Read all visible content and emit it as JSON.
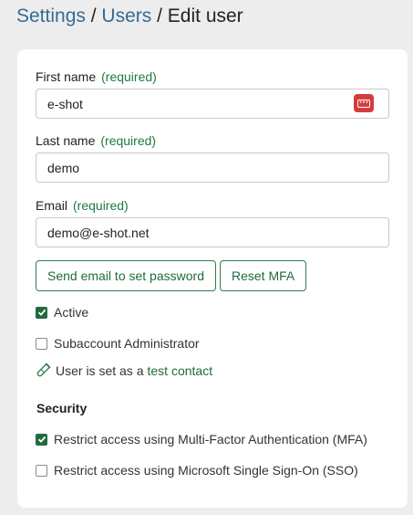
{
  "breadcrumb": {
    "settings": "Settings",
    "separator": "/",
    "users": "Users",
    "current": "Edit user"
  },
  "form": {
    "first_name": {
      "label": "First name",
      "required": "(required)",
      "value": "e-shot"
    },
    "last_name": {
      "label": "Last name",
      "required": "(required)",
      "value": "demo"
    },
    "email": {
      "label": "Email",
      "required": "(required)",
      "value": "demo@e-shot.net"
    },
    "password_manager_icon": "password-manager-icon",
    "buttons": {
      "send_email": "Send email to set password",
      "reset_mfa": "Reset MFA"
    },
    "active": {
      "label": "Active",
      "checked": true
    },
    "subaccount_admin": {
      "label": "Subaccount Administrator",
      "checked": false
    },
    "contact": {
      "prefix": "User is set as a",
      "link": "test contact",
      "icon": "test-tube-icon"
    },
    "security": {
      "title": "Security",
      "mfa": {
        "label": "Restrict access using Multi-Factor Authentication (MFA)",
        "checked": true
      },
      "sso": {
        "label": "Restrict access using Microsoft Single Sign-On (SSO)",
        "checked": false
      }
    }
  },
  "colors": {
    "background": "#ededed",
    "link_blue": "#356b95",
    "accent_green": "#1f6b3f",
    "required_green": "#1f7a43",
    "badge_red": "#d63c3c"
  }
}
